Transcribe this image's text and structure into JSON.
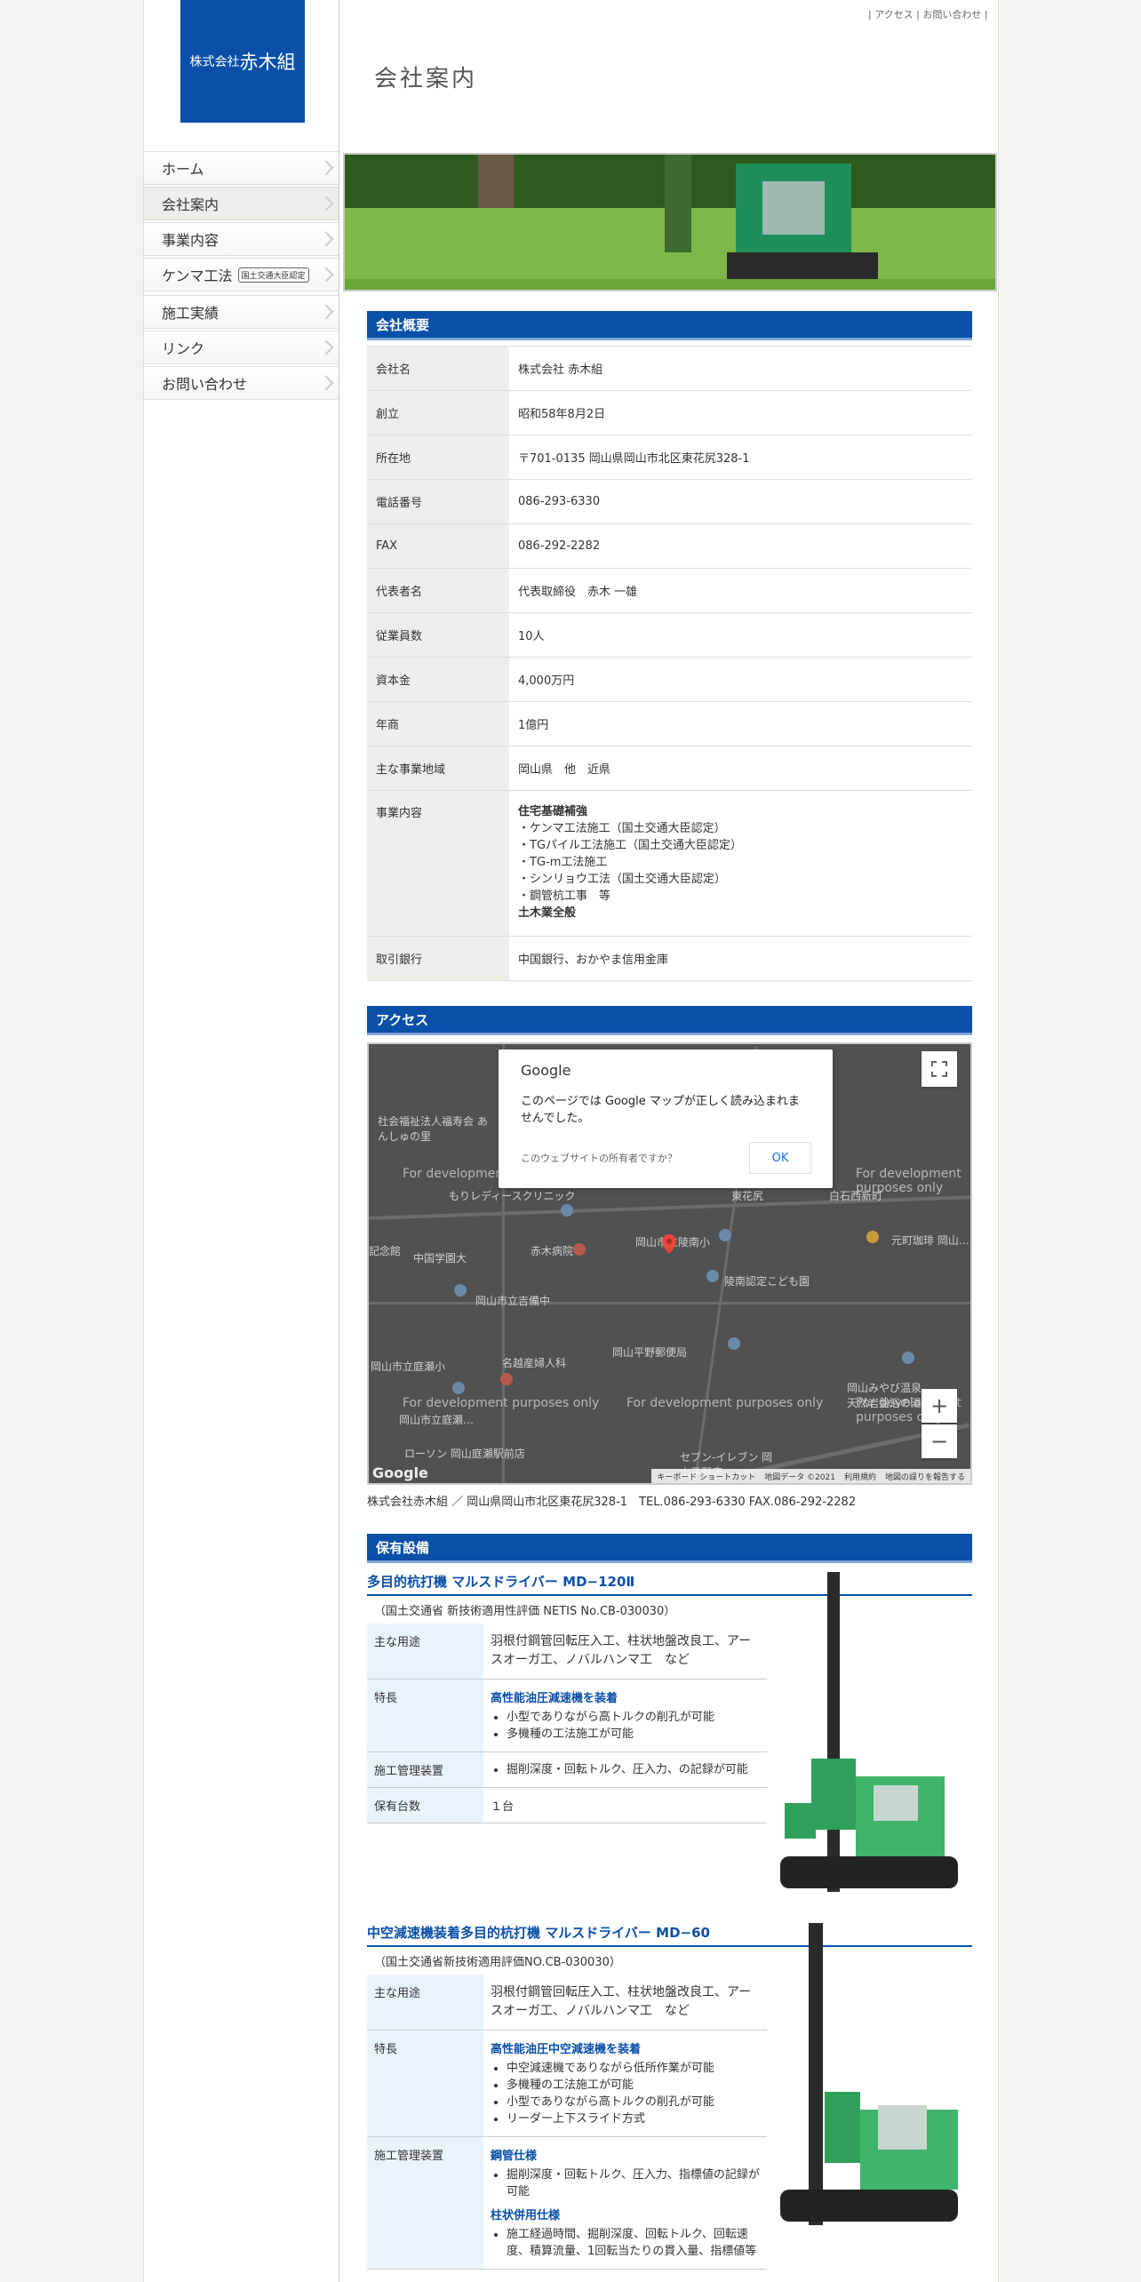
{
  "brand": {
    "logo_small": "株式会社",
    "logo_big": "赤木組"
  },
  "top_links": {
    "access": "アクセス",
    "contact": "お問い合わせ"
  },
  "page_title": "会社案内",
  "nav": [
    {
      "label": "ホーム"
    },
    {
      "label": "会社案内"
    },
    {
      "label": "事業内容"
    },
    {
      "label": "ケンマ工法",
      "badge": "国土交通大臣認定"
    },
    {
      "label": "施工実績"
    },
    {
      "label": "リンク"
    },
    {
      "label": "お問い合わせ"
    }
  ],
  "overview": {
    "heading": "会社概要",
    "rows": [
      {
        "k": "会社名",
        "v": "株式会社 赤木組"
      },
      {
        "k": "創立",
        "v": "昭和58年8月2日"
      },
      {
        "k": "所在地",
        "v": "〒701-0135 岡山県岡山市北区東花尻328-1"
      },
      {
        "k": "電話番号",
        "v": "086-293-6330"
      },
      {
        "k": "FAX",
        "v": "086-292-2282"
      },
      {
        "k": "代表者名",
        "v": "代表取締役　赤木 一雄"
      },
      {
        "k": "従業員数",
        "v": "10人"
      },
      {
        "k": "資本金",
        "v": "4,000万円"
      },
      {
        "k": "年商",
        "v": "1億円"
      },
      {
        "k": "主な事業地域",
        "v": "岡山県　他　近県"
      }
    ],
    "business": {
      "k": "事業内容",
      "title": "住宅基礎補強",
      "items": [
        "・ケンマ工法施工（国土交通大臣認定）",
        "・TGパイル工法施工（国土交通大臣認定）",
        "・TG-m工法施工",
        "・シンリョウ工法（国土交通大臣認定）",
        "・鋼管杭工事　等"
      ],
      "footer": "土木業全般"
    },
    "bank": {
      "k": "取引銀行",
      "v": "中国銀行、おかやま信用金庫"
    }
  },
  "access": {
    "heading": "アクセス",
    "map": {
      "google": "Google",
      "message": "このページでは Google マップが正しく読み込まれませんでした。",
      "owner_q": "このウェブサイトの所有者ですか？",
      "ok": "OK",
      "dev_text": "For development purposes only",
      "zoom_in": "+",
      "zoom_out": "−",
      "footer": [
        "キーボード ショートカット",
        "地図データ ©2021",
        "利用規約",
        "地図の誤りを報告する"
      ],
      "labels": [
        "社会福祉法人福寿会 あんしゅの里",
        "もりレディースクリニック",
        "東花尻",
        "白石西新町",
        "元町珈琲 岡山…",
        "中国学園大",
        "赤木病院",
        "岡山市立吉備中",
        "岡山市立庭瀬小",
        "陵南認定こども園",
        "岡山平野郵便局",
        "名越産婦人科",
        "岡山市立庭瀬…",
        "ローソン 岡山庭瀬駅前店",
        "セブン-イレブン 岡山平野店",
        "岡山みやび温泉 天然岩盤浴の湯",
        "記念館",
        "岡山市立陵南小"
      ]
    },
    "address_line": "株式会社赤木組 ／ 岡山県岡山市北区東花尻328-1　TEL.086-293-6330 FAX.086-292-2282"
  },
  "equipment": {
    "heading": "保有設備",
    "items": [
      {
        "title": "多目的杭打機 マルスドライバー MD−120Ⅱ",
        "sub": "（国土交通省 新技術適用性評価 NETIS No.CB-030030）",
        "use_k": "主な用途",
        "use_v": "羽根付鋼管回転圧入工、柱状地盤改良工、アースオーガ工、ノバルハンマ工　など",
        "feature_k": "特長",
        "feature_title": "高性能油圧減速機を装着",
        "features": [
          "小型でありながら高トルクの削孔が可能",
          "多機種の工法施工が可能"
        ],
        "control_k": "施工管理装置",
        "controls": [
          "掘削深度・回転トルク、圧入力、の記録が可能"
        ],
        "count_k": "保有台数",
        "count_v": "１台"
      },
      {
        "title": "中空減速機装着多目的杭打機 マルスドライバー MD−60",
        "sub": "（国土交通省新技術適用評価NO.CB-030030）",
        "use_k": "主な用途",
        "use_v": "羽根付鋼管回転圧入工、柱状地盤改良工、アースオーガ工、ノバルハンマ工　など",
        "feature_k": "特長",
        "feature_title": "高性能油圧中空減速機を装着",
        "features": [
          "中空減速機でありながら低所作業が可能",
          "多機種の工法施工が可能",
          "小型でありながら高トルクの削孔が可能",
          "リーダー上下スライド方式"
        ],
        "control_k": "施工管理装置",
        "control_title1": "鋼管仕様",
        "controls": [
          "掘削深度・回転トルク、圧入力、指標値の記録が可能"
        ],
        "control_title2": "柱状併用仕様",
        "controls2": [
          "施工経過時間、掘削深度、回転トルク、回転速度、積算流量、1回転当たりの貫入量、指標値等"
        ]
      }
    ]
  }
}
